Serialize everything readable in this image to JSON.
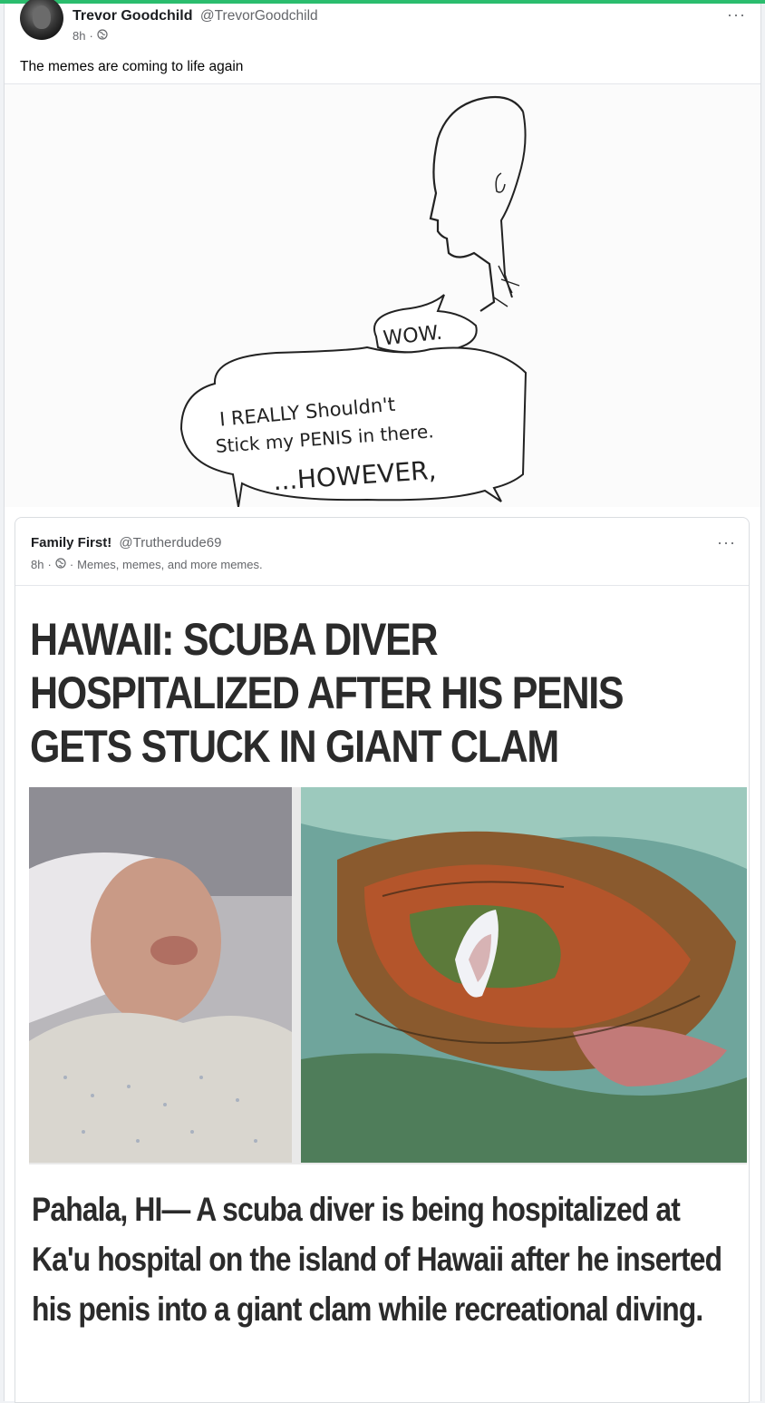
{
  "post": {
    "author": "Trevor Goodchild",
    "handle": "@TrevorGoodchild",
    "time": "8h",
    "separator": "·",
    "text": "The memes are coming to life again",
    "more_label": "···",
    "icons": {
      "privacy": "globe-icon",
      "more": "more-options-icon"
    },
    "meme_text": {
      "bubble1": "WOW.",
      "bubble2_line1": "I REALLY Shouldn't",
      "bubble2_line2": "Stick my PENIS in there.",
      "bubble2_line3": "...HOWEVER,"
    }
  },
  "shared_post": {
    "author": "Family First!",
    "handle": "@Trutherdude69",
    "time": "8h",
    "separator": "·",
    "caption": "Memes, memes, and more memes.",
    "more_label": "···",
    "article": {
      "headline": "HAWAII:  SCUBA DIVER\nHOSPITALIZED AFTER HIS PENIS\nGETS STUCK IN GIANT CLAM",
      "body": "Pahala, HI— A scuba diver is being hospitalized at Ka'u hospital on the island of Hawaii after he inserted his penis into a giant clam while recreational diving."
    }
  },
  "colors": {
    "accent": "#2bbd6e",
    "text": "#050505",
    "secondary": "#65676b"
  }
}
